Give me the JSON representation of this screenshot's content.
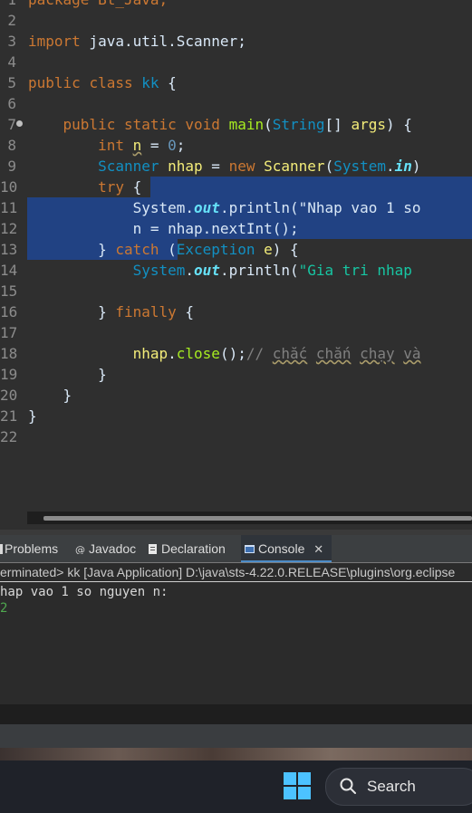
{
  "editor": {
    "lines": [
      {
        "num": "1",
        "tokens": [
          {
            "t": "package Bt_Java;",
            "c": "kw"
          }
        ]
      },
      {
        "num": "2",
        "tokens": []
      },
      {
        "num": "3",
        "tokens": [
          {
            "t": "import",
            "c": "kw"
          },
          {
            "t": " java.util.Scanner;",
            "c": ""
          }
        ]
      },
      {
        "num": "4",
        "tokens": []
      },
      {
        "num": "5",
        "tokens": [
          {
            "t": "public",
            "c": "kw"
          },
          {
            "t": " ",
            "c": ""
          },
          {
            "t": "class",
            "c": "kw"
          },
          {
            "t": " ",
            "c": ""
          },
          {
            "t": "kk",
            "c": "typ"
          },
          {
            "t": " {",
            "c": ""
          }
        ]
      },
      {
        "num": "6",
        "tokens": []
      },
      {
        "num": "7",
        "tokens": [
          {
            "t": "    ",
            "c": ""
          },
          {
            "t": "public",
            "c": "kw"
          },
          {
            "t": " ",
            "c": ""
          },
          {
            "t": "static",
            "c": "kw"
          },
          {
            "t": " ",
            "c": ""
          },
          {
            "t": "void",
            "c": "kw"
          },
          {
            "t": " ",
            "c": ""
          },
          {
            "t": "main",
            "c": "fn"
          },
          {
            "t": "(",
            "c": ""
          },
          {
            "t": "String",
            "c": "typ"
          },
          {
            "t": "[] ",
            "c": ""
          },
          {
            "t": "args",
            "c": "var"
          },
          {
            "t": ") {",
            "c": ""
          }
        ]
      },
      {
        "num": "8",
        "tokens": [
          {
            "t": "        ",
            "c": ""
          },
          {
            "t": "int",
            "c": "kw"
          },
          {
            "t": " ",
            "c": ""
          },
          {
            "t": "n",
            "c": "var sq"
          },
          {
            "t": " = ",
            "c": ""
          },
          {
            "t": "0",
            "c": "num"
          },
          {
            "t": ";",
            "c": ""
          }
        ]
      },
      {
        "num": "9",
        "tokens": [
          {
            "t": "        ",
            "c": ""
          },
          {
            "t": "Scanner",
            "c": "typ"
          },
          {
            "t": " ",
            "c": ""
          },
          {
            "t": "nhap",
            "c": "var"
          },
          {
            "t": " = ",
            "c": ""
          },
          {
            "t": "new",
            "c": "kw"
          },
          {
            "t": " ",
            "c": ""
          },
          {
            "t": "Scanner",
            "c": "var"
          },
          {
            "t": "(",
            "c": ""
          },
          {
            "t": "System",
            "c": "typ"
          },
          {
            "t": ".",
            "c": ""
          },
          {
            "t": "in",
            "c": "fld"
          },
          {
            "t": ")",
            "c": ""
          }
        ]
      },
      {
        "num": "10",
        "tokens": [
          {
            "t": "        ",
            "c": ""
          },
          {
            "t": "try",
            "c": "kw"
          },
          {
            "t": " {",
            "c": ""
          }
        ]
      },
      {
        "num": "11",
        "tokens": [
          {
            "t": "            System.",
            "c": ""
          },
          {
            "t": "out",
            "c": "fld"
          },
          {
            "t": ".println(\"Nhap vao 1 so",
            "c": ""
          }
        ]
      },
      {
        "num": "12",
        "tokens": [
          {
            "t": "            n = nhap.nextInt();",
            "c": ""
          }
        ]
      },
      {
        "num": "13",
        "tokens": [
          {
            "t": "        } ",
            "c": ""
          },
          {
            "t": "catch",
            "c": "kw"
          },
          {
            "t": " (",
            "c": ""
          },
          {
            "t": "Exception",
            "c": "typ"
          },
          {
            "t": " ",
            "c": ""
          },
          {
            "t": "e",
            "c": "var"
          },
          {
            "t": ") {",
            "c": ""
          }
        ]
      },
      {
        "num": "14",
        "tokens": [
          {
            "t": "            ",
            "c": ""
          },
          {
            "t": "System",
            "c": "typ"
          },
          {
            "t": ".",
            "c": ""
          },
          {
            "t": "out",
            "c": "fld"
          },
          {
            "t": ".println(",
            "c": ""
          },
          {
            "t": "\"Gia tri nhap",
            "c": "str"
          }
        ]
      },
      {
        "num": "15",
        "tokens": []
      },
      {
        "num": "16",
        "tokens": [
          {
            "t": "        } ",
            "c": ""
          },
          {
            "t": "finally",
            "c": "kw"
          },
          {
            "t": " {",
            "c": ""
          }
        ]
      },
      {
        "num": "17",
        "tokens": []
      },
      {
        "num": "18",
        "tokens": [
          {
            "t": "            ",
            "c": ""
          },
          {
            "t": "nhap",
            "c": "var"
          },
          {
            "t": ".",
            "c": ""
          },
          {
            "t": "close",
            "c": "fn"
          },
          {
            "t": "();",
            "c": ""
          },
          {
            "t": "// ",
            "c": "cmt"
          },
          {
            "t": "chắc",
            "c": "cmt sq"
          },
          {
            "t": " ",
            "c": "cmt"
          },
          {
            "t": "chắn",
            "c": "cmt sq"
          },
          {
            "t": " ",
            "c": "cmt"
          },
          {
            "t": "chạy",
            "c": "cmt sq"
          },
          {
            "t": " ",
            "c": "cmt"
          },
          {
            "t": "và",
            "c": "cmt sq"
          }
        ]
      },
      {
        "num": "19",
        "tokens": [
          {
            "t": "        }",
            "c": ""
          }
        ]
      },
      {
        "num": "20",
        "tokens": [
          {
            "t": "    }",
            "c": ""
          }
        ]
      },
      {
        "num": "21",
        "tokens": [
          {
            "t": "}",
            "c": ""
          }
        ]
      },
      {
        "num": "22",
        "tokens": []
      }
    ]
  },
  "tabs": [
    {
      "label": "Problems",
      "icon": "problems-icon"
    },
    {
      "label": "Javadoc",
      "icon": "javadoc-icon"
    },
    {
      "label": "Declaration",
      "icon": "declaration-icon"
    },
    {
      "label": "Console",
      "icon": "console-icon",
      "active": true
    }
  ],
  "console": {
    "terminated": "erminated> kk [Java Application] D:\\java\\sts-4.22.0.RELEASE\\plugins\\org.eclipse",
    "output_line": "hap vao 1 so nguyen n:",
    "input_line": "2"
  },
  "taskbar": {
    "search_label": "Search",
    "start_icon": "windows-start-icon",
    "accent": "#4cc2ff"
  }
}
